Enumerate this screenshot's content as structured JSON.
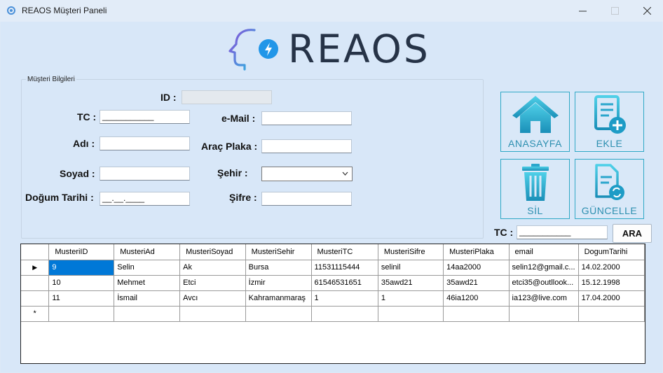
{
  "window": {
    "title": "REAOS Müşteri Paneli",
    "minimize_icon": "minimize-icon",
    "maximize_icon": "maximize-icon",
    "close_icon": "close-icon"
  },
  "logo": {
    "text": "REAOS"
  },
  "group": {
    "legend": "Müşteri Bilgileri",
    "id_label": "ID :",
    "id_value": "",
    "tc_label": "TC :",
    "tc_value": "___________",
    "email_label": "e-Mail :",
    "email_value": "",
    "ad_label": "Adı :",
    "ad_value": "",
    "plaka_label": "Araç Plaka :",
    "plaka_value": "",
    "soyad_label": "Soyad :",
    "soyad_value": "",
    "sehir_label": "Şehir :",
    "sehir_value": "",
    "dogum_label": "Doğum Tarihi :",
    "dogum_value": "__.__.____",
    "sifre_label": "Şifre :",
    "sifre_value": ""
  },
  "buttons": {
    "anasayfa": "ANASAYFA",
    "ekle": "EKLE",
    "sil": "SİL",
    "guncelle": "GÜNCELLE",
    "ara": "ARA"
  },
  "search": {
    "tc_label": "TC :",
    "tc_value": "___________"
  },
  "colors": {
    "accent": "#2fa8c6",
    "selection": "#0078d7",
    "background": "#d8e7f8"
  },
  "grid": {
    "columns": [
      "MusteriID",
      "MusteriAd",
      "MusteriSoyad",
      "MusteriSehir",
      "MusteriTC",
      "MusteriSifre",
      "MusteriPlaka",
      "email",
      "DogumTarihi"
    ],
    "rows": [
      [
        "9",
        "Selin",
        "Ak",
        "Bursa",
        "11531115444",
        "selinil",
        "14aa2000",
        "selin12@gmail.c...",
        "14.02.2000"
      ],
      [
        "10",
        "Mehmet",
        "Etci",
        "İzmir",
        "61546531651",
        "35awd21",
        "35awd21",
        "etci35@outllook...",
        "15.12.1998"
      ],
      [
        "11",
        "İsmail",
        "Avcı",
        "Kahramanmaraş",
        "1",
        "1",
        "46ia1200",
        "ia123@live.com",
        "17.04.2000"
      ]
    ],
    "current_row_marker": "▶",
    "new_row_marker": "*"
  }
}
